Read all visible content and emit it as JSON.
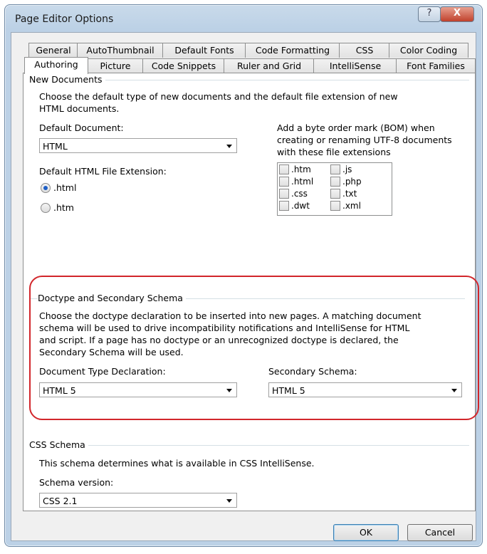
{
  "window": {
    "title": "Page Editor Options",
    "help_glyph": "?",
    "close_glyph": "X"
  },
  "tabs_row1": [
    "General",
    "AutoThumbnail",
    "Default Fonts",
    "Code Formatting",
    "CSS",
    "Color Coding"
  ],
  "tabs_row2": [
    "Authoring",
    "Picture",
    "Code Snippets",
    "Ruler and Grid",
    "IntelliSense",
    "Font Families"
  ],
  "active_tab": "Authoring",
  "new_documents": {
    "heading": "New Documents",
    "description_line1": "Choose the default type of new documents and the default file extension of new",
    "description_line2": "HTML documents.",
    "default_document_label": "Default Document:",
    "default_document_value": "HTML",
    "extension_label": "Default HTML File Extension:",
    "ext_option1": ".html",
    "ext_option2": ".htm",
    "ext_selected": ".html",
    "bom_line1": "Add a byte order mark (BOM) when",
    "bom_line2": "creating or renaming UTF-8 documents",
    "bom_line3": "with these file extensions",
    "bom_extensions": [
      ".htm",
      ".js",
      ".html",
      ".php",
      ".css",
      ".txt",
      ".dwt",
      ".xml"
    ]
  },
  "doctype": {
    "heading": "Doctype and Secondary Schema",
    "line1": "Choose the doctype declaration to be inserted into new pages. A matching document",
    "line2": "schema will be used to drive incompatibility notifications and IntelliSense for HTML",
    "line3": "and script. If a page has no doctype or an unrecognized doctype is declared, the",
    "line4": "Secondary Schema will be used.",
    "doctype_label": "Document Type Declaration:",
    "doctype_value": "HTML 5",
    "secondary_label": "Secondary Schema:",
    "secondary_value": "HTML 5",
    "highlight_color": "#d2262b"
  },
  "css_schema": {
    "heading": "CSS Schema",
    "description": "This schema determines what is available in CSS IntelliSense.",
    "version_label": "Schema version:",
    "version_value": "CSS 2.1"
  },
  "buttons": {
    "ok": "OK",
    "cancel": "Cancel"
  }
}
